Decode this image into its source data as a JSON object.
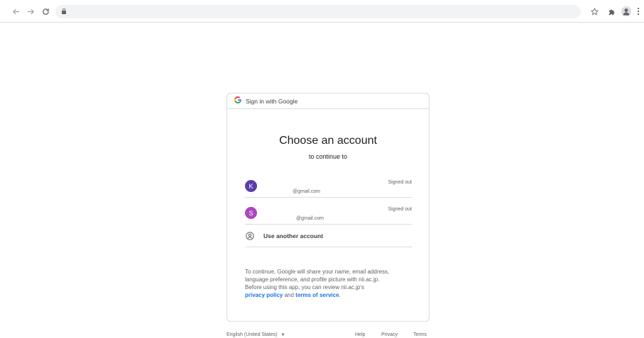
{
  "browser": {
    "back_icon": "back-arrow-icon",
    "forward_icon": "forward-arrow-icon",
    "reload_icon": "reload-icon",
    "lock_icon": "lock-icon",
    "url": "",
    "bookmark_icon": "star-icon",
    "extensions_icon": "puzzle-icon",
    "profile_icon": "profile-icon",
    "menu_icon": "kebab-menu-icon"
  },
  "card": {
    "header_text": "Sign in with Google",
    "title": "Choose an account",
    "subtitle": "to continue to",
    "accounts": [
      {
        "initial": "K",
        "email": "@gmail.com",
        "status": "Signed out",
        "color": "#5b3fa8"
      },
      {
        "initial": "S",
        "email": "@gmail.com",
        "status": "Signed out",
        "color": "#ab47bc"
      }
    ],
    "use_another": "Use another account",
    "disclaimer": {
      "line1": "To continue, Google will share your name, email address,",
      "line2": "language preference, and profile picture with nii.ac.jp.",
      "line3": "Before using this app, you can review nii.ac.jp's",
      "privacy_link": "privacy policy",
      "and": " and ",
      "terms_link": "terms of service",
      "end": "."
    }
  },
  "footer": {
    "language": "English (United States)",
    "help": "Help",
    "privacy": "Privacy",
    "terms": "Terms"
  },
  "colors": {
    "link": "#1a73e8",
    "border": "#dadce0"
  }
}
